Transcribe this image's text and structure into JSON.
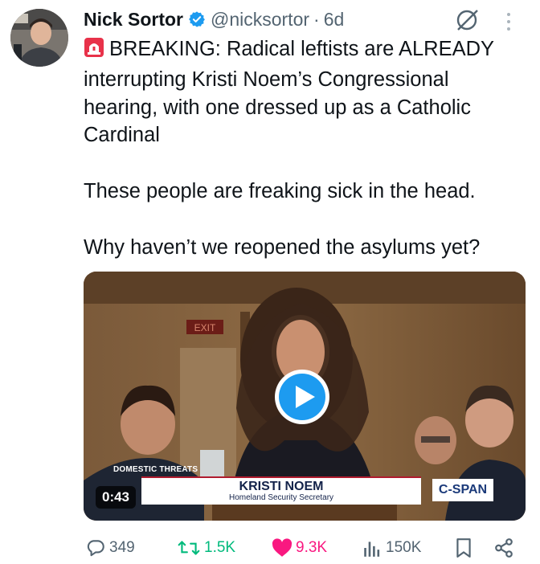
{
  "author": {
    "name": "Nick Sortor",
    "handle": "@nicksortor",
    "separator": "·",
    "time": "6d"
  },
  "tweet": {
    "paragraph1": "BREAKING: Radical leftists are ALREADY interrupting Kristi Noem’s Congressional hearing, with one dressed up as a Catholic Cardinal",
    "paragraph2": "These people are freaking sick in the head.",
    "paragraph3": "Why haven’t we reopened the asylums yet?"
  },
  "video": {
    "duration": "0:43",
    "topic_tag": "DOMESTIC THREATS",
    "lower_third_name": "KRISTI NOEM",
    "lower_third_title": "Homeland Security Secretary",
    "network": "C-SPAN",
    "exit_sign": "EXIT"
  },
  "actions": {
    "replies": "349",
    "reposts": "1.5K",
    "likes": "9.3K",
    "views": "150K"
  },
  "colors": {
    "verified": "#1d9bf0",
    "like": "#f91880",
    "repost": "#00ba7c",
    "muted": "#536471",
    "play": "#1d9bf0"
  }
}
